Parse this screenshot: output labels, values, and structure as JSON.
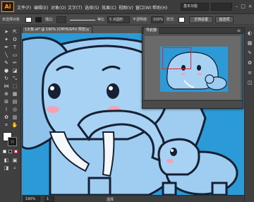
{
  "app": {
    "logo": "Ai"
  },
  "menu": {
    "items": [
      "文件(F)",
      "编辑(E)",
      "对象(O)",
      "文字(T)",
      "选择(S)",
      "效果(C)",
      "视图(V)",
      "窗口(W)",
      "帮助(H)"
    ],
    "workspace": "基本功能",
    "window_buttons": [
      "–",
      "□",
      "×"
    ]
  },
  "control": {
    "selection_label": "未选择对象",
    "stroke_label": "描边:",
    "stroke_value": "",
    "brush_label": "等比",
    "brush_value": "5 点圆形",
    "opacity_label": "不透明度:",
    "opacity_value": "100%",
    "style_label": "样式:",
    "doc_setup_button": "文档设置",
    "prefs_button": "首选项",
    "colors": {
      "fill": "#ffffff",
      "stroke": "#1a1a1a"
    }
  },
  "document": {
    "tab_title": "1大象.ai* @ 190% (CMYK/GPU 预览)",
    "close": "×"
  },
  "navigator": {
    "title": "导航器",
    "menu_icon": "≡"
  },
  "status": {
    "zoom": "190%",
    "page": "1",
    "tool_label": "选择"
  },
  "toolbar": {
    "tools": [
      "selection-tool-icon",
      "direct-selection-tool-icon",
      "magic-wand-icon",
      "lasso-icon",
      "pen-icon",
      "type-icon",
      "line-icon",
      "rectangle-icon",
      "paintbrush-icon",
      "pencil-icon",
      "blob-brush-icon",
      "eraser-icon",
      "rotate-icon",
      "scale-icon",
      "width-icon",
      "free-transform-icon",
      "shape-builder-icon",
      "perspective-grid-icon",
      "mesh-icon",
      "gradient-icon",
      "eyedropper-icon",
      "blend-icon",
      "symbol-sprayer-icon",
      "column-graph-icon",
      "artboard-icon",
      "slice-icon",
      "hand-icon",
      "zoom-icon"
    ]
  },
  "colors": {
    "canvas_bg": "#2b9ad6",
    "elephant_body": "#9fcdf1",
    "outline": "#152033",
    "cheek": "#f2a4b5",
    "tusk": "#f4f8fb",
    "nav_frame": "#e4242c",
    "logo_orange": "#f29a1f"
  }
}
